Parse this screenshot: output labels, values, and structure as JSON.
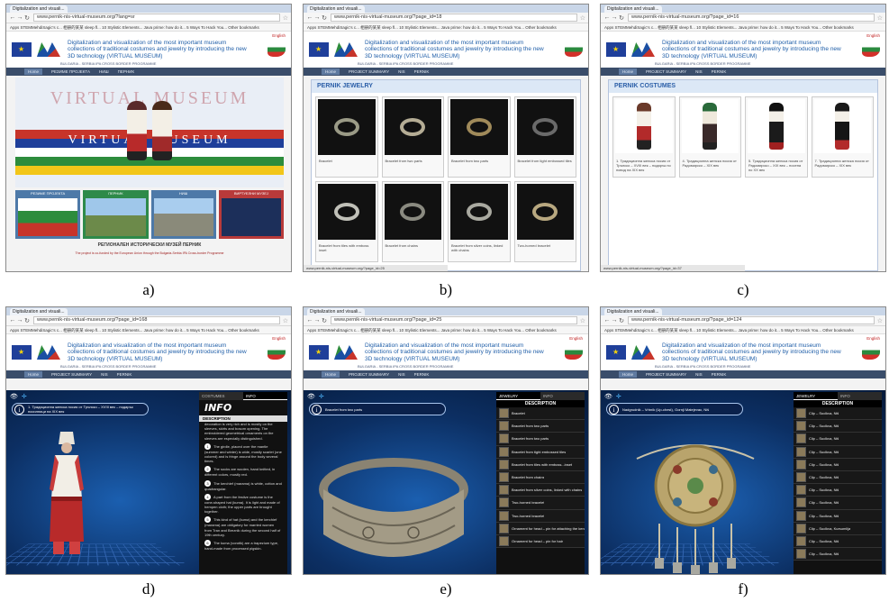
{
  "common": {
    "tab_title": "Digitalization and visuali...",
    "bookmarks_text": "Apps  STEMMehdiSagic's c...  相册的某某 sleep fl...  10 Stylistic Elements...  Java prime: how do it...  5 Ways To Hack You...  Other bookmarks",
    "site_title_line1": "Digitalization and visualization of the most important museum collections of traditional",
    "site_title_line2": "costumes and jewelry by introducing the new 3D technology (VIRTUAL MUSEUM)",
    "site_sub": "BULGARIA - SERBIA IPA CROSS BORDER PROGRAMME",
    "lang": "English",
    "nav_a": [
      "Home",
      "РЕЗИМЕ ПРОЈЕКТА",
      "НИШ",
      "ПЕРНИК"
    ],
    "nav_en": [
      "Home",
      "PROJECT SUMMARY",
      "NIS",
      "PERNIK"
    ]
  },
  "screens": {
    "a": {
      "url": "www.pernik-nis-virtual-museum.org/?lang=sr",
      "hero_title": "VIRTUAL MUSEUM",
      "hero_banner": "VIRTUAL  MUSEUM",
      "tiles": [
        "РЕЗИМЕ ПРОЈЕКТА",
        "ПЕРНИК",
        "НИШ",
        "ВИРТУЕЛНИ МУЗЕЈ"
      ],
      "museum_name": "РЕГИОНАЛЕН ИСТОРИЧЕСКИ МУЗЕЙ  ПЕРНИК",
      "fine_print": "The project is co-funded by the European Union through the Bulgaria-Serbia IPA Cross-border Programme"
    },
    "b": {
      "url": "www.pernik-nis-virtual-museum.org/?page_id=18",
      "heading": "PERNIK JEWELRY",
      "items": [
        "Bracelet",
        "Bracelet from two parts",
        "Bracelet from two parts",
        "Bracelet from tight embossed tiles",
        "Bracelet from tiles with emboss inset",
        "Bracelet from chains",
        "Bracelet from silver coins, linked with chains",
        "Two-horned bracelet"
      ],
      "status": "www.pernik-nis-virtual-museum.org/?page_id=25"
    },
    "c": {
      "url": "www.pernik-nis-virtual-museum.org/?page_id=16",
      "heading": "PERNIK COSTUMES",
      "items": [
        "1. Традиционна женска носия от Трънско – XVIII век – подарък по повод на XIX век",
        "4. Традиционна женска носия от Радомирско – XIX век",
        "5. Традиционна женска носия от Радомирско – XIX век – носена по XX век",
        "7. Традиционна женска носия от Радомирско – XIX век"
      ],
      "status": "www.pernik-nis-virtual-museum.org/?page_id=37"
    },
    "d": {
      "url": "www.pernik-nis-virtual-museum.org/?page_id=168",
      "info_text": "1. Традиционна женска носия от Трънско – XVIII век – подарък посилници на XIX век",
      "tabs": [
        "COSTUMES",
        "INFO"
      ],
      "info_heading": "INFO",
      "desc_label": "DESCRIPTION",
      "paragraphs": [
        "decoration is very rich and is mostly on the sleeves, skirts and bosom opening. The embroidered geometrical ornaments on the sleeves are especially distinguished.",
        "The girdle, placed over the mantle (summer and winter) is wide, mostly scarlet (one colored) and is fringe around the body several times.",
        "The socks are woolen, hand knitted, in different colors, mostly red.",
        "The kerchief (marama) is white, cotton and quadrangular.",
        "A part from the festive costume is the cone-shaped hat (kuma). It is light and made of hempen cloth; the upper parts are brought together.",
        "This kind of hat (kuma) and the kerchief (marama) are obligatory for married women from Tran and Breznik during the second half of 19th century.",
        "The kuma (vorotik) are a trapezium type, hand-made from processed pigskin."
      ]
    },
    "e": {
      "url": "www.pernik-nis-virtual-museum.org/?page_id=25",
      "info_text": "Bracelet from two parts",
      "tabs": [
        "JEWELRY",
        "INFO"
      ],
      "desc_label": "DESCRIPTION",
      "list": [
        "Bracelet",
        "Bracelet from two parts",
        "Bracelet from two parts",
        "Bracelet from tight embossed tiles",
        "Bracelet from tiles with emboss...inset",
        "Bracelet from chains",
        "Bracelet from silver coins, linked with chains",
        "Two-horned bracelet",
        "Two-horned bracelet",
        "Ornament for head – pin for attaching the kerchief to the hair",
        "Ornament for head – pin for hair"
      ]
    },
    "f": {
      "url": "www.pernik-nis-virtual-museum.org/?page_id=124",
      "info_text": "Nadgrudnik – Vrbnik (Up-chest), Gornji Matejevac, Niš",
      "tabs": [
        "JEWELRY",
        "INFO"
      ],
      "desc_label": "DESCRIPTION",
      "list": [
        "Clip – Suclkva, Niš",
        "Clip – Suclkva, Niš",
        "Clip – Suclkva, Niš",
        "Clip – Suclkva, Niš",
        "Clip – Suclkva, Niš",
        "Clip – Suclkva, Niš",
        "Clip – Suclkva, Niš",
        "Clip – Suclkva, Niš",
        "Clip – Suclkva, Niš",
        "Clip – Suclkva, Kursumlija",
        "Clip – Suclkva, Niš",
        "Clip – Suclkva, Niš"
      ]
    }
  },
  "captions": [
    "a)",
    "b)",
    "c)",
    "d)",
    "e)",
    "f)"
  ],
  "colors": {
    "site_blue": "#1f5ea8",
    "viewer_dark": "#0c2f63",
    "navbar": "#3a4d6a"
  }
}
